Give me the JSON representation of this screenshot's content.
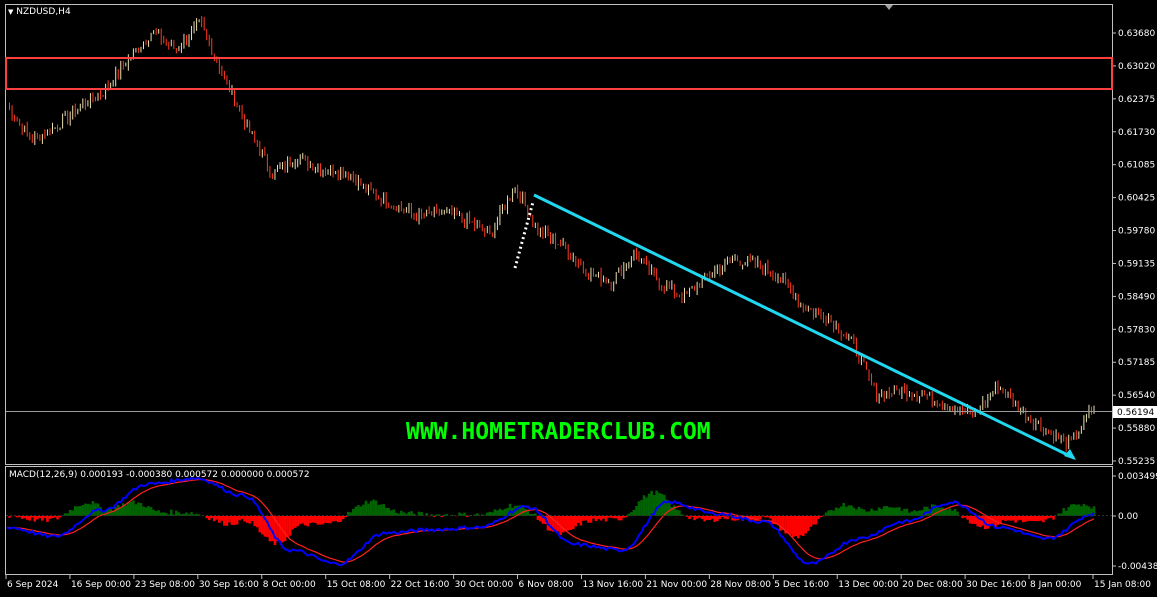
{
  "main_header": {
    "symbol": "NZDUSD,H4"
  },
  "macd_header": {
    "text": "MACD(12,26,9) 0.000193 -0.000380 0.000572 0.000000 0.000572"
  },
  "watermark": "WWW.HOMETRADERCLUB.COM",
  "current_price": "0.56194",
  "colors": {
    "background": "#000000",
    "frame": "#c0c0c0",
    "bull": "#e8e0b0",
    "bear": "#ff3b1f",
    "zone": "#ff4040",
    "trendline": "#20d8f0",
    "macd_line": "#0000ff",
    "signal_line": "#ff2020",
    "hist_pos": "#006400",
    "hist_neg": "#ff0000",
    "watermark": "#00ff00"
  },
  "price_axis": {
    "labels": [
      "0.63680",
      "0.63020",
      "0.62375",
      "0.61730",
      "0.61085",
      "0.60425",
      "0.59780",
      "0.59135",
      "0.58490",
      "0.57830",
      "0.57185",
      "0.56540",
      "0.55880",
      "0.55235"
    ]
  },
  "macd_axis": {
    "labels": [
      "0.003499",
      "0.00",
      "-0.004389"
    ]
  },
  "time_axis": {
    "labels": [
      "6 Sep 2024",
      "16 Sep 00:00",
      "23 Sep 08:00",
      "30 Sep 16:00",
      "8 Oct 00:00",
      "15 Oct 08:00",
      "22 Oct 16:00",
      "30 Oct 00:00",
      "6 Nov 08:00",
      "13 Nov 16:00",
      "21 Nov 00:00",
      "28 Nov 08:00",
      "5 Dec 16:00",
      "13 Dec 00:00",
      "20 Dec 08:00",
      "30 Dec 16:00",
      "8 Jan 00:00",
      "15 Jan 08:00"
    ]
  },
  "chart_data": {
    "type": "candlestick",
    "symbol": "NZDUSD",
    "timeframe": "H4",
    "price_range": [
      0.551,
      0.6395
    ],
    "close_path": [
      [
        "6 Sep 2024",
        0.62
      ],
      [
        "10 Sep",
        0.6135
      ],
      [
        "13 Sep",
        0.616
      ],
      [
        "16 Sep",
        0.62
      ],
      [
        "19 Sep",
        0.623
      ],
      [
        "23 Sep",
        0.629
      ],
      [
        "25 Sep",
        0.6345
      ],
      [
        "27 Sep",
        0.631
      ],
      [
        "30 Sep",
        0.6362
      ],
      [
        "2 Oct",
        0.6255
      ],
      [
        "4 Oct",
        0.6155
      ],
      [
        "8 Oct",
        0.607
      ],
      [
        "10 Oct",
        0.61
      ],
      [
        "15 Oct",
        0.608
      ],
      [
        "18 Oct",
        0.6075
      ],
      [
        "22 Oct",
        0.6035
      ],
      [
        "25 Oct",
        0.601
      ],
      [
        "28 Oct",
        0.5985
      ],
      [
        "30 Oct",
        0.5995
      ],
      [
        "1 Nov",
        0.598
      ],
      [
        "5 Nov",
        0.595
      ],
      [
        "6 Nov",
        0.6045
      ],
      [
        "8 Nov",
        0.596
      ],
      [
        "11 Nov",
        0.593
      ],
      [
        "13 Nov",
        0.588
      ],
      [
        "15 Nov",
        0.586
      ],
      [
        "18 Nov",
        0.5915
      ],
      [
        "21 Nov",
        0.586
      ],
      [
        "22 Nov",
        0.583
      ],
      [
        "25 Nov",
        0.587
      ],
      [
        "28 Nov",
        0.5905
      ],
      [
        "2 Dec",
        0.5895
      ],
      [
        "5 Dec",
        0.587
      ],
      [
        "9 Dec",
        0.581
      ],
      [
        "13 Dec",
        0.579
      ],
      [
        "17 Dec",
        0.574
      ],
      [
        "19 Dec",
        0.564
      ],
      [
        "20 Dec",
        0.565
      ],
      [
        "24 Dec",
        0.564
      ],
      [
        "30 Dec",
        0.562
      ],
      [
        "2 Jan",
        0.56
      ],
      [
        "6 Jan",
        0.566
      ],
      [
        "8 Jan",
        0.561
      ],
      [
        "10 Jan",
        0.557
      ],
      [
        "13 Jan",
        0.5545
      ],
      [
        "15 Jan",
        0.5619
      ]
    ],
    "resistance_zone": [
      0.6265,
      0.6315
    ],
    "trendline": {
      "from": [
        "6 Nov 04:00",
        0.6045
      ],
      "to": [
        "13 Jan 12:00",
        0.5528
      ]
    },
    "dotted_line": {
      "from": [
        "4 Nov 20:00",
        0.592
      ],
      "to": [
        "6 Nov 00:00",
        0.6042
      ]
    },
    "current_price": 0.56194,
    "macd": {
      "params": "12,26,9",
      "range": [
        -0.004389,
        0.003499
      ],
      "path": [
        [
          "6 Sep",
          -0.001
        ],
        [
          "10 Sep",
          -0.0018
        ],
        [
          "16 Sep",
          0.0005
        ],
        [
          "23 Sep",
          0.0028
        ],
        [
          "27 Sep",
          0.0033
        ],
        [
          "30 Sep",
          0.0018
        ],
        [
          "4 Oct",
          -0.003
        ],
        [
          "8 Oct",
          -0.0042
        ],
        [
          "15 Oct",
          -0.0015
        ],
        [
          "22 Oct",
          -0.0012
        ],
        [
          "30 Oct",
          -0.001
        ],
        [
          "6 Nov",
          0.0008
        ],
        [
          "13 Nov",
          -0.0025
        ],
        [
          "21 Nov",
          -0.003
        ],
        [
          "28 Nov",
          0.0012
        ],
        [
          "5 Dec",
          0.0002
        ],
        [
          "13 Dec",
          -0.0005
        ],
        [
          "18 Dec",
          -0.0042
        ],
        [
          "24 Dec",
          -0.002
        ],
        [
          "30 Dec",
          -0.0005
        ],
        [
          "3 Jan",
          0.0012
        ],
        [
          "8 Jan",
          -0.001
        ],
        [
          "13 Jan",
          -0.002
        ],
        [
          "15 Jan",
          0.0002
        ]
      ]
    }
  }
}
